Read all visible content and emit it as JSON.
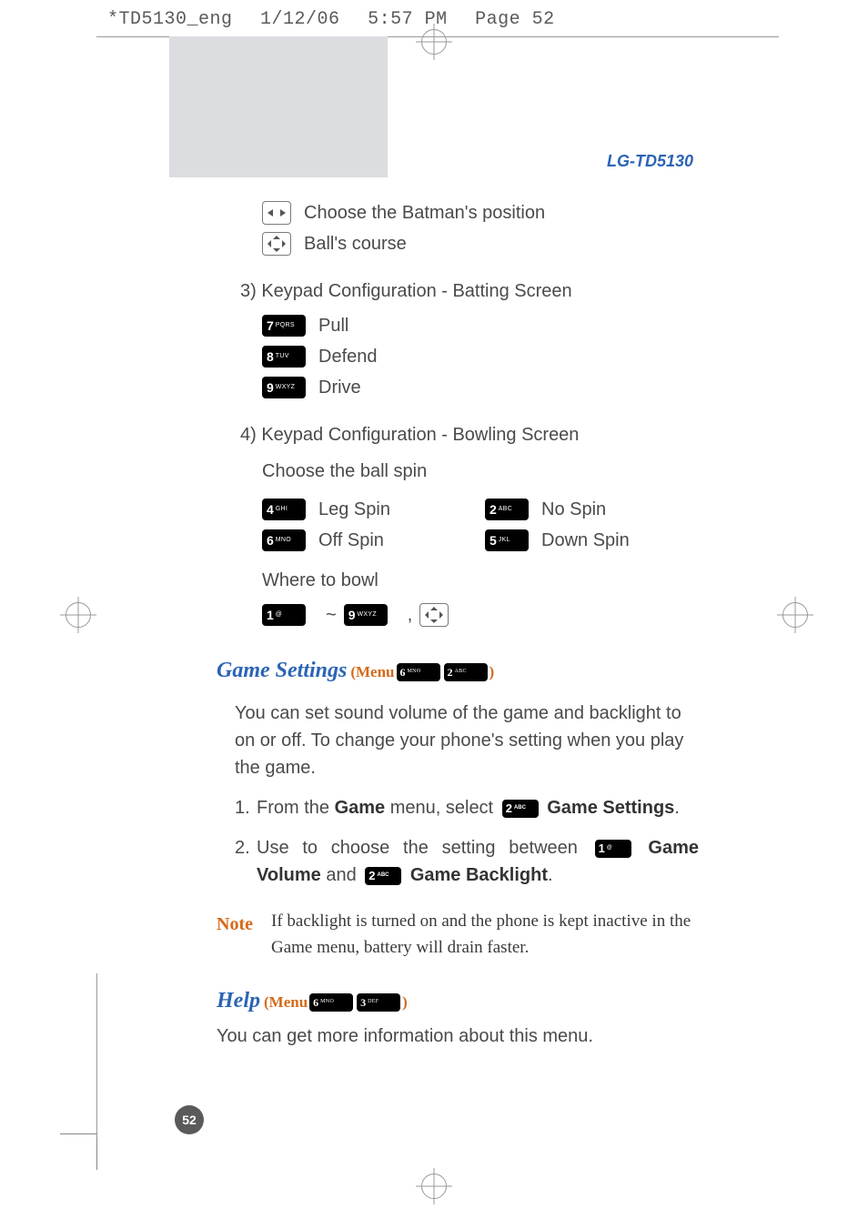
{
  "header": {
    "file": "*TD5130_eng",
    "date": "1/12/06",
    "time": "5:57 PM",
    "page_label": "Page 52"
  },
  "model": "LG-TD5130",
  "controls": {
    "position_label": "Choose the Batman's position",
    "course_label": "Ball's course"
  },
  "batting": {
    "title": "3) Keypad Configuration - Batting Screen",
    "k7": "7",
    "k7sub": "PQRS",
    "k7label": "Pull",
    "k8": "8",
    "k8sub": "TUV",
    "k8label": "Defend",
    "k9": "9",
    "k9sub": "WXYZ",
    "k9label": "Drive"
  },
  "bowling": {
    "title": "4) Keypad Configuration - Bowling Screen",
    "spin_title": "Choose the ball spin",
    "k4": "4",
    "k4sub": "GHI",
    "k4label": "Leg Spin",
    "k2": "2",
    "k2sub": "ABC",
    "k2label": "No Spin",
    "k6": "6",
    "k6sub": "MNO",
    "k6label": "Off Spin",
    "k5": "5",
    "k5sub": "JKL",
    "k5label": "Down Spin",
    "where_title": "Where to bowl",
    "k1": "1",
    "k1sub": "@",
    "k9": "9",
    "k9sub": "WXYZ",
    "tilde": "~",
    "comma": ","
  },
  "game_settings": {
    "title": "Game Settings",
    "menu_prefix": "(Menu",
    "menu_suffix": ")",
    "m6": "6",
    "m6sub": "MNO",
    "m2": "2",
    "m2sub": "ABC",
    "para": "You can set sound volume of the game and backlight to on or off. To change your phone's setting when you play the game.",
    "step1_pre": "From the ",
    "step1_game": "Game",
    "step1_mid": " menu, select ",
    "step1_k2": "2",
    "step1_k2sub": "ABC",
    "step1_gs": " Game Settings",
    "step1_end": ".",
    "step2_pre": "Use to choose the setting between ",
    "step2_k1": "1",
    "step2_k1sub": "@",
    "step2_gv": " Game Volume",
    "step2_and": " and ",
    "step2_k2": "2",
    "step2_k2sub": "ABC",
    "step2_gb": " Game Backlight",
    "step2_end": "."
  },
  "note": {
    "label": "Note",
    "text": "If backlight is turned on and the phone is kept inactive in the Game menu, battery will drain faster."
  },
  "help": {
    "title": "Help",
    "menu_prefix": "(Menu",
    "menu_suffix": ")",
    "m6": "6",
    "m6sub": "MNO",
    "m3": "3",
    "m3sub": "DEF",
    "text": "You can get more information about this menu."
  },
  "page_number": "52"
}
